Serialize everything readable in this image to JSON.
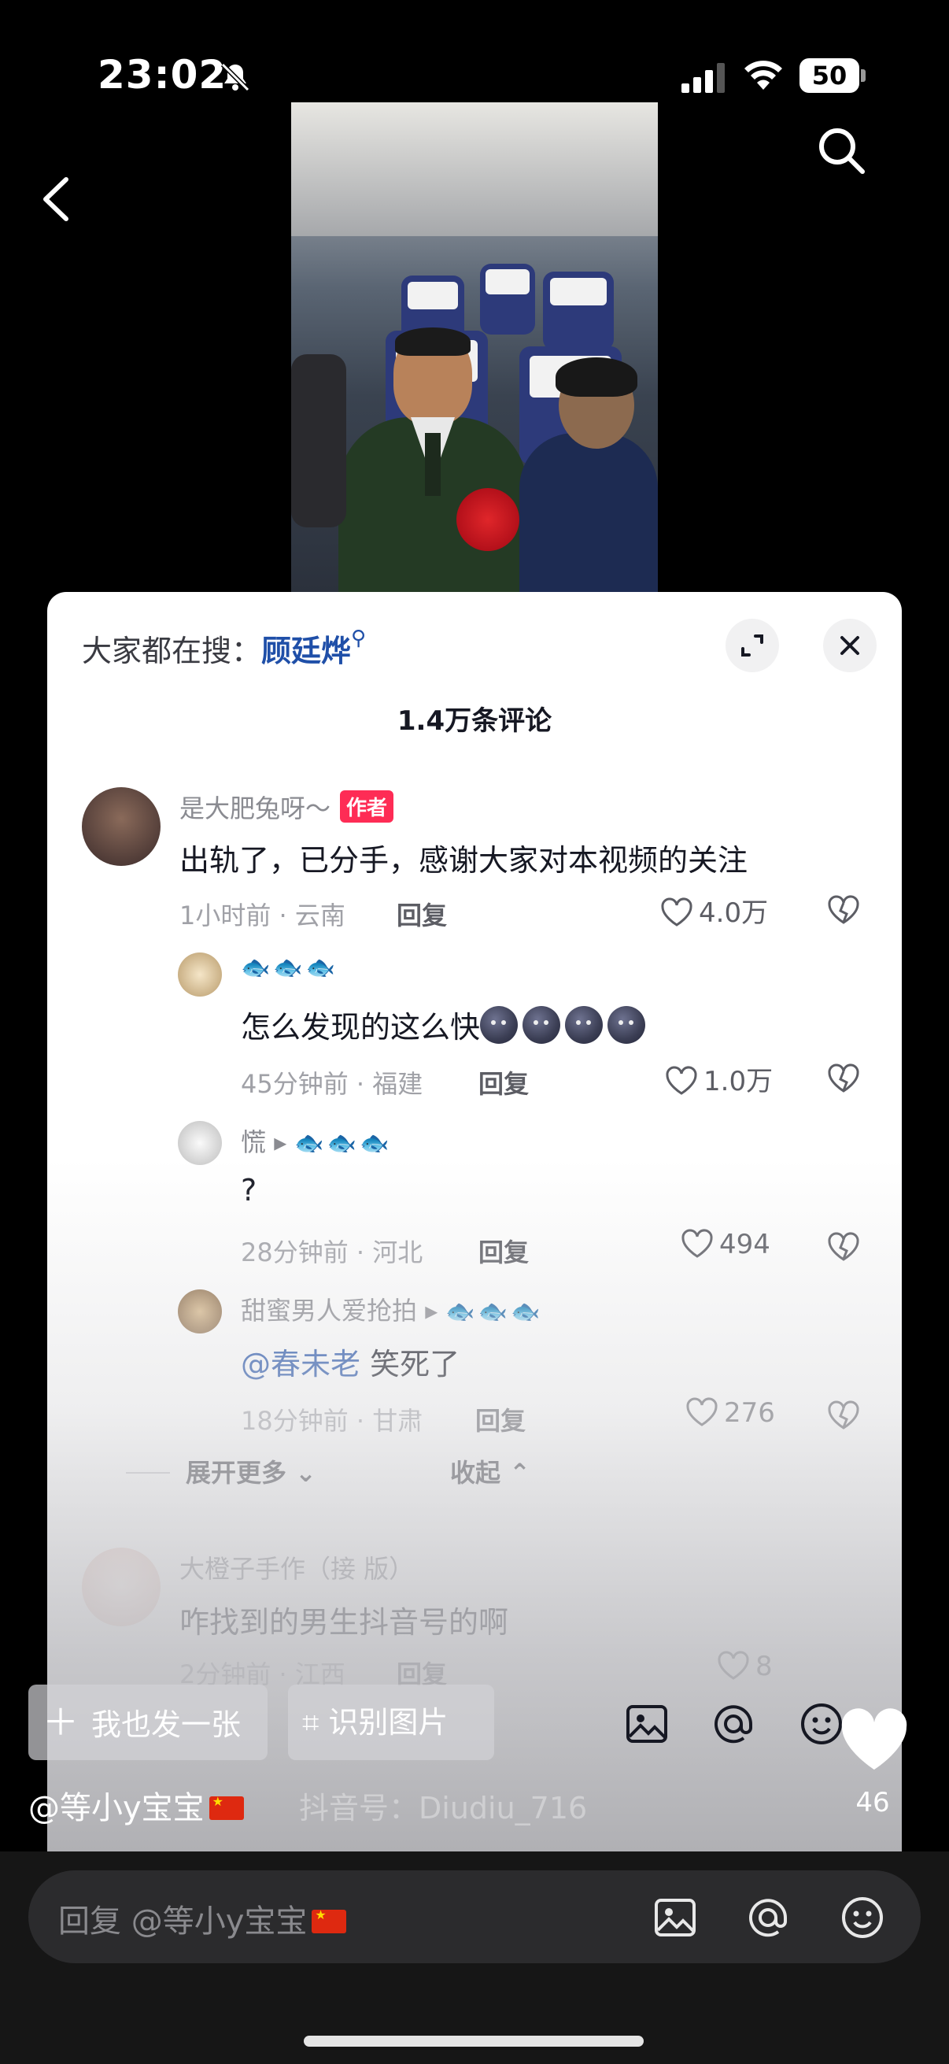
{
  "status_bar": {
    "time": "23:02",
    "battery": "50"
  },
  "comments_panel": {
    "hot_search_prefix": "大家都在搜：",
    "hot_search_term": "顾廷烨",
    "comment_count": "1.4万条评论",
    "comments": [
      {
        "user": "是大肥兔呀～",
        "tag": "作者",
        "text": "出轨了，已分手，感谢大家对本视频的关注",
        "meta": "1小时前 · 云南",
        "reply_label": "回复",
        "likes": "4.0万"
      },
      {
        "user": "🐟🐟🐟",
        "text": "怎么发现的这么快",
        "meta": "45分钟前 · 福建",
        "reply_label": "回复",
        "likes": "1.0万"
      },
      {
        "user": "慌",
        "reply_to": "🐟🐟🐟",
        "text": "?",
        "meta": "28分钟前 · 河北",
        "reply_label": "回复",
        "likes": "494"
      },
      {
        "user": "甜蜜男人爱抢拍",
        "reply_to": "🐟🐟🐟",
        "mention": "@春未老",
        "text": " 笑死了",
        "meta": "18分钟前 · 甘肃",
        "reply_label": "回复",
        "likes": "276"
      },
      {
        "user": "大橙子手作（接 版）",
        "text": "咋找到的男生抖音号的啊",
        "meta": "2分钟前 · 江西",
        "reply_label": "回复",
        "likes": "8"
      }
    ],
    "expand_more": "展开更多",
    "collapse": "收起"
  },
  "overlay": {
    "post_button": "我也发一张",
    "identify_button": "识别图片",
    "author_handle": "@等小y宝宝",
    "like_count": "46",
    "watermark": "抖音号：Diudiu_716"
  },
  "reply_bar": {
    "placeholder": "回复 @等小y宝宝"
  },
  "colors": {
    "accent_red": "#fe2c55",
    "mention_blue": "#1f4fa8"
  }
}
